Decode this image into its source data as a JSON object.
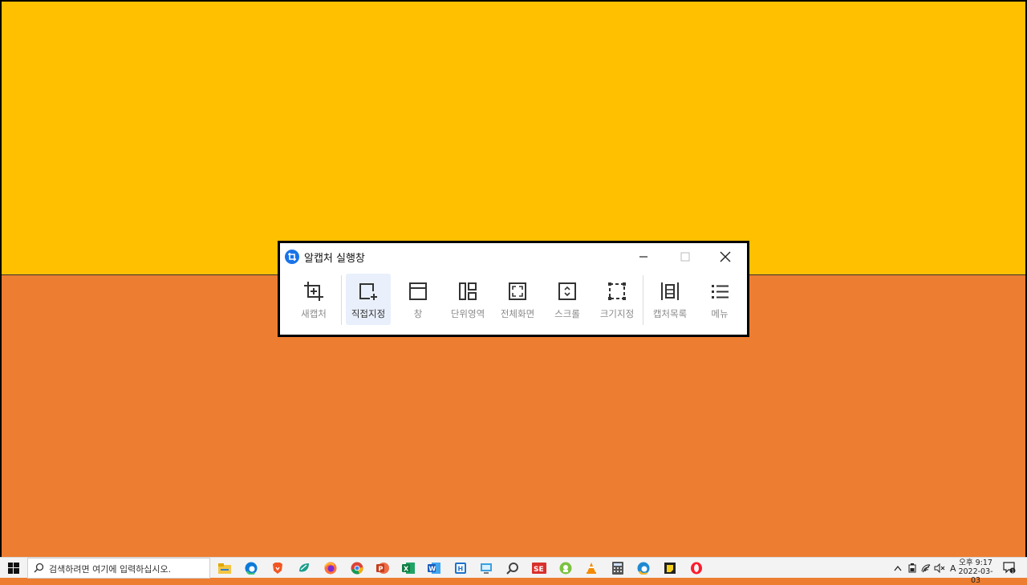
{
  "window": {
    "title": "알캡처 실행창",
    "controls": {
      "minimize": "–",
      "maximize": "☐",
      "close": "✕"
    }
  },
  "toolbar": {
    "items": [
      {
        "label": "새캡처",
        "icon": "crop-plus-icon",
        "active": false
      },
      {
        "label": "직접지정",
        "icon": "rect-plus-icon",
        "active": true
      },
      {
        "label": "창",
        "icon": "window-icon",
        "active": false
      },
      {
        "label": "단위영역",
        "icon": "region-icon",
        "active": false
      },
      {
        "label": "전체화면",
        "icon": "fullscreen-icon",
        "active": false
      },
      {
        "label": "스크롤",
        "icon": "scroll-icon",
        "active": false
      },
      {
        "label": "크기지정",
        "icon": "size-icon",
        "active": false
      },
      {
        "label": "캡처목록",
        "icon": "capture-list-icon",
        "active": false
      },
      {
        "label": "메뉴",
        "icon": "menu-icon",
        "active": false
      }
    ]
  },
  "taskbar": {
    "search_placeholder": "검색하려면 여기에 입력하십시오.",
    "apps": [
      "file-explorer-icon",
      "edge-icon",
      "brave-icon",
      "app-green-icon",
      "firefox-icon",
      "chrome-icon",
      "powerpoint-icon",
      "excel-icon",
      "word-icon",
      "hangul-icon",
      "remote-desktop-icon",
      "search-app-icon",
      "app-red-se-icon",
      "app-green-circle-icon",
      "vlc-icon",
      "calculator-icon",
      "edge-beta-icon",
      "sticky-notes-icon",
      "opera-icon"
    ],
    "tray": {
      "ime": "A",
      "time": "오후 9:17",
      "date": "2022-03-03"
    }
  },
  "colors": {
    "top_band": "#ffc000",
    "bottom_band": "#ed7d31",
    "logo": "#1a73e8",
    "active_tool_bg": "#e9f0fb"
  }
}
